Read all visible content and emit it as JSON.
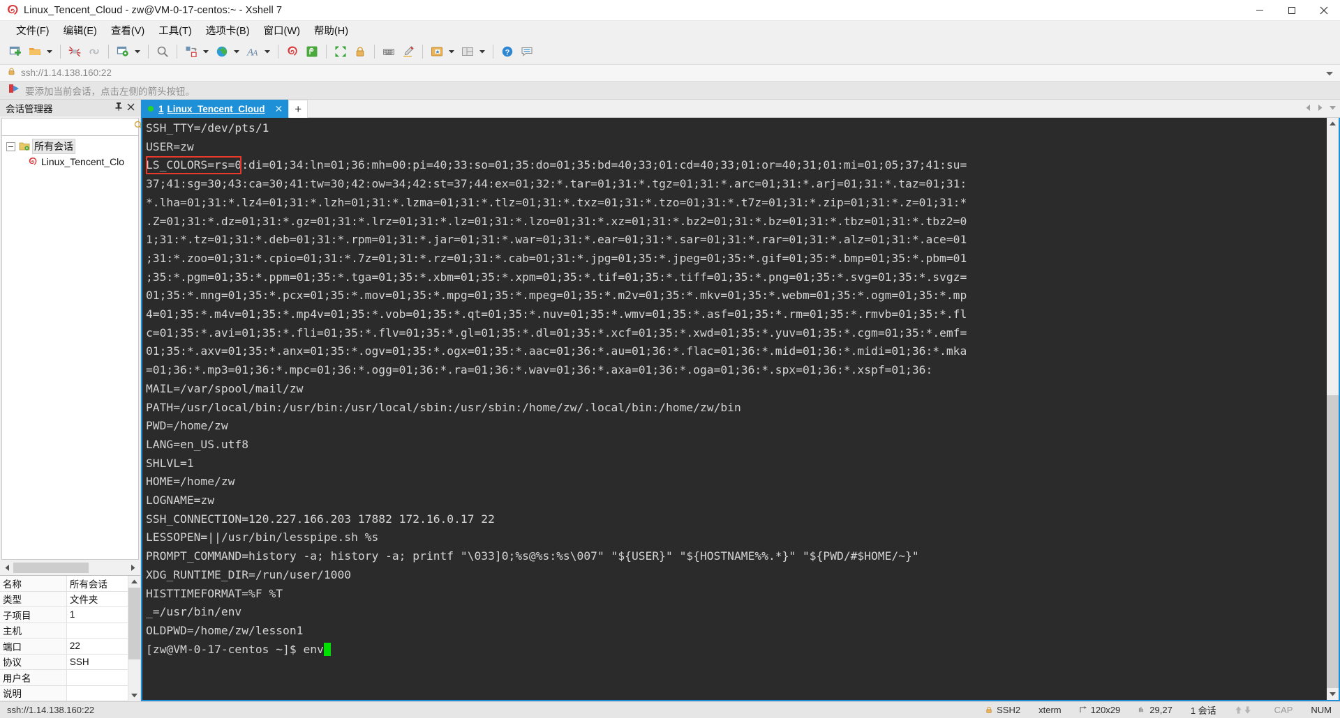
{
  "window": {
    "title": "Linux_Tencent_Cloud - zw@VM-0-17-centos:~ - Xshell 7",
    "minimize_label": "Minimize",
    "maximize_label": "Maximize",
    "close_label": "Close"
  },
  "menubar": {
    "items": [
      {
        "label": "文件(F)",
        "name": "menu-file"
      },
      {
        "label": "编辑(E)",
        "name": "menu-edit"
      },
      {
        "label": "查看(V)",
        "name": "menu-view"
      },
      {
        "label": "工具(T)",
        "name": "menu-tools"
      },
      {
        "label": "选项卡(B)",
        "name": "menu-tabs"
      },
      {
        "label": "窗口(W)",
        "name": "menu-window"
      },
      {
        "label": "帮助(H)",
        "name": "menu-help"
      }
    ]
  },
  "toolbar": {
    "icons": [
      "new-session-icon",
      "open-folder-icon",
      "disconnect-icon",
      "reconnect-icon",
      "session-properties-icon",
      "find-icon",
      "transfer-file-icon",
      "globe-icon",
      "font-icon",
      "xshell-icon",
      "xftp-icon",
      "fullscreen-icon",
      "lock-icon",
      "keyboard-icon",
      "highlight-icon",
      "layout-icon",
      "split-layout-icon",
      "help-icon",
      "comment-icon"
    ]
  },
  "address_bar": {
    "value": "ssh://1.14.138.160:22",
    "lock_icon": "lock-icon",
    "dropdown_icon": "chevron-down-icon"
  },
  "hint_bar": {
    "icon": "red-arrow-icon",
    "text": "要添加当前会话，点击左侧的箭头按钮。"
  },
  "sidebar": {
    "header_title": "会话管理器",
    "pin_icon": "pin-icon",
    "close_icon": "close-icon",
    "search": {
      "value": "",
      "placeholder": "",
      "icon": "search-icon"
    },
    "tree": {
      "root": {
        "label": "所有会话",
        "icon": "folder-icon",
        "expanded": true
      },
      "children": [
        {
          "label": "Linux_Tencent_Clo",
          "icon": "xshell-session-icon"
        }
      ]
    },
    "hscroll": {
      "left_arrow": "chevron-left-icon",
      "right_arrow": "chevron-right-icon"
    },
    "properties": {
      "header": {
        "key": "名称",
        "value": "所有会话"
      },
      "rows": [
        {
          "key": "类型",
          "value": "文件夹"
        },
        {
          "key": "子项目",
          "value": "1"
        },
        {
          "key": "主机",
          "value": ""
        },
        {
          "key": "端口",
          "value": "22"
        },
        {
          "key": "协议",
          "value": "SSH"
        },
        {
          "key": "用户名",
          "value": ""
        },
        {
          "key": "说明",
          "value": ""
        }
      ],
      "scroll_up_icon": "chevron-up-icon",
      "scroll_down_icon": "chevron-down-icon"
    }
  },
  "tabs": {
    "items": [
      {
        "index": "1",
        "label": "Linux_Tencent_Cloud",
        "active": true,
        "status_dot": "connected",
        "close_icon": "close-icon"
      }
    ],
    "new_tab_label": "+",
    "scroll_left_icon": "chevron-left-icon",
    "scroll_right_icon": "chevron-right-icon",
    "tab_menu_icon": "chevron-down-icon"
  },
  "terminal": {
    "lines": [
      "SSH_TTY=/dev/pts/1",
      "USER=zw",
      "LS_COLORS=rs=0:di=01;34:ln=01;36:mh=00:pi=40;33:so=01;35:do=01;35:bd=40;33;01:cd=40;33;01:or=40;31;01:mi=01;05;37;41:su=",
      "37;41:sg=30;43:ca=30;41:tw=30;42:ow=34;42:st=37;44:ex=01;32:*.tar=01;31:*.tgz=01;31:*.arc=01;31:*.arj=01;31:*.taz=01;31:",
      "*.lha=01;31:*.lz4=01;31:*.lzh=01;31:*.lzma=01;31:*.tlz=01;31:*.txz=01;31:*.tzo=01;31:*.t7z=01;31:*.zip=01;31:*.z=01;31:*",
      ".Z=01;31:*.dz=01;31:*.gz=01;31:*.lrz=01;31:*.lz=01;31:*.lzo=01;31:*.xz=01;31:*.bz2=01;31:*.bz=01;31:*.tbz=01;31:*.tbz2=0",
      "1;31:*.tz=01;31:*.deb=01;31:*.rpm=01;31:*.jar=01;31:*.war=01;31:*.ear=01;31:*.sar=01;31:*.rar=01;31:*.alz=01;31:*.ace=01",
      ";31:*.zoo=01;31:*.cpio=01;31:*.7z=01;31:*.rz=01;31:*.cab=01;31:*.jpg=01;35:*.jpeg=01;35:*.gif=01;35:*.bmp=01;35:*.pbm=01",
      ";35:*.pgm=01;35:*.ppm=01;35:*.tga=01;35:*.xbm=01;35:*.xpm=01;35:*.tif=01;35:*.tiff=01;35:*.png=01;35:*.svg=01;35:*.svgz=",
      "01;35:*.mng=01;35:*.pcx=01;35:*.mov=01;35:*.mpg=01;35:*.mpeg=01;35:*.m2v=01;35:*.mkv=01;35:*.webm=01;35:*.ogm=01;35:*.mp",
      "4=01;35:*.m4v=01;35:*.mp4v=01;35:*.vob=01;35:*.qt=01;35:*.nuv=01;35:*.wmv=01;35:*.asf=01;35:*.rm=01;35:*.rmvb=01;35:*.fl",
      "c=01;35:*.avi=01;35:*.fli=01;35:*.flv=01;35:*.gl=01;35:*.dl=01;35:*.xcf=01;35:*.xwd=01;35:*.yuv=01;35:*.cgm=01;35:*.emf=",
      "01;35:*.axv=01;35:*.anx=01;35:*.ogv=01;35:*.ogx=01;35:*.aac=01;36:*.au=01;36:*.flac=01;36:*.mid=01;36:*.midi=01;36:*.mka",
      "=01;36:*.mp3=01;36:*.mpc=01;36:*.ogg=01;36:*.ra=01;36:*.wav=01;36:*.axa=01;36:*.oga=01;36:*.spx=01;36:*.xspf=01;36:",
      "MAIL=/var/spool/mail/zw",
      "PATH=/usr/local/bin:/usr/bin:/usr/local/sbin:/usr/sbin:/home/zw/.local/bin:/home/zw/bin",
      "PWD=/home/zw",
      "LANG=en_US.utf8",
      "SHLVL=1",
      "HOME=/home/zw",
      "LOGNAME=zw",
      "SSH_CONNECTION=120.227.166.203 17882 172.16.0.17 22",
      "LESSOPEN=||/usr/bin/lesspipe.sh %s",
      "PROMPT_COMMAND=history -a; history -a; printf \"\\033]0;%s@%s:%s\\007\" \"${USER}\" \"${HOSTNAME%%.*}\" \"${PWD/#$HOME/~}\"",
      "XDG_RUNTIME_DIR=/run/user/1000",
      "HISTTIMEFORMAT=%F %T",
      "_=/usr/bin/env",
      "OLDPWD=/home/zw/lesson1"
    ],
    "prompt": "[zw@VM-0-17-centos ~]$ ",
    "command": "env",
    "cursor": "block",
    "annotation_box": {
      "label": "LS_COLORS=",
      "color": "#e8392b"
    }
  },
  "statusbar": {
    "url": "ssh://1.14.138.160:22",
    "cells": [
      {
        "name": "security-cell",
        "icon": "lock-icon",
        "text": "SSH2",
        "dim": false
      },
      {
        "name": "terminal-type-cell",
        "icon": "",
        "text": "xterm",
        "dim": false
      },
      {
        "name": "size-cell",
        "icon": "resize-icon",
        "text": "120x29",
        "dim": false
      },
      {
        "name": "cursor-pos-cell",
        "icon": "cursor-icon",
        "text": "29,27",
        "dim": false
      },
      {
        "name": "session-count-cell",
        "icon": "",
        "text": "1 会话",
        "dim": false
      },
      {
        "name": "transfer-cell",
        "icon": "updown-arrows-icon",
        "text": "",
        "dim": true
      },
      {
        "name": "caps-cell",
        "icon": "",
        "text": "CAP",
        "dim": true
      },
      {
        "name": "num-cell",
        "icon": "",
        "text": "NUM",
        "dim": false
      }
    ]
  }
}
